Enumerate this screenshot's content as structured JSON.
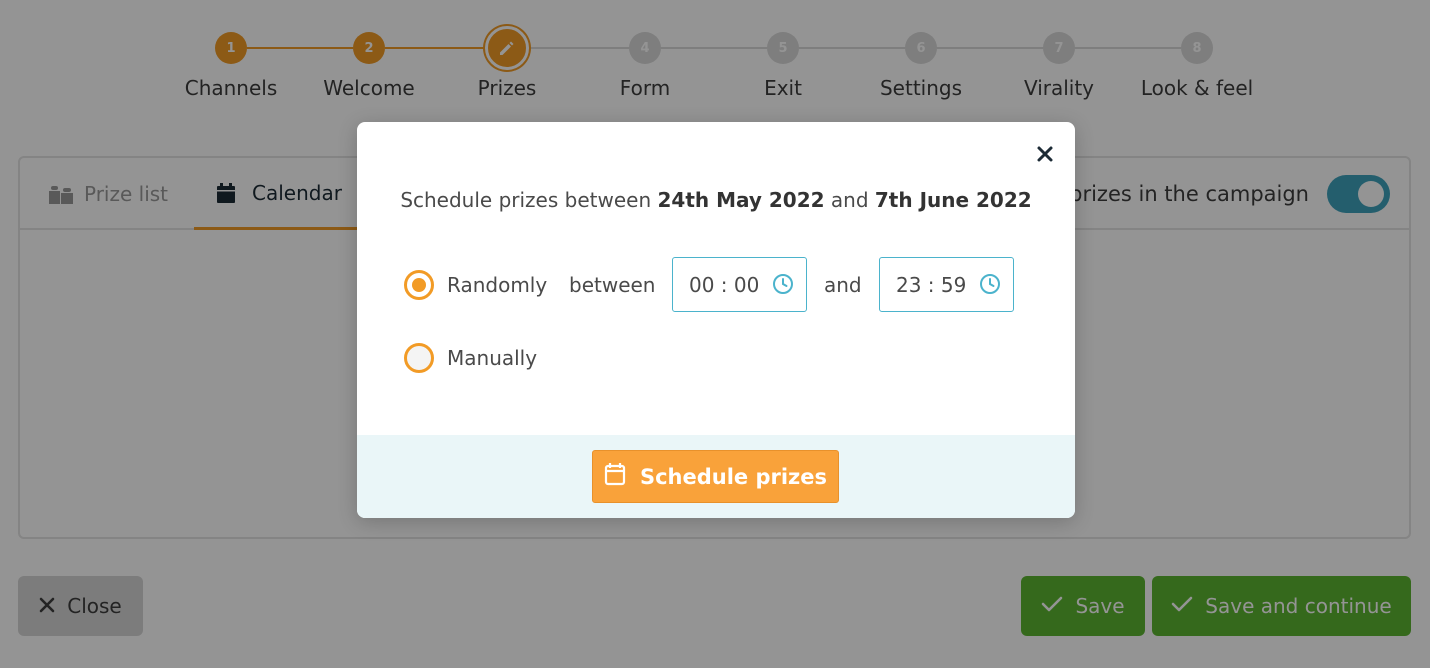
{
  "stepper": {
    "steps": [
      {
        "number": "1",
        "label": "Channels",
        "state": "done"
      },
      {
        "number": "2",
        "label": "Welcome",
        "state": "done"
      },
      {
        "number": "",
        "label": "Prizes",
        "state": "current"
      },
      {
        "number": "4",
        "label": "Form",
        "state": "todo"
      },
      {
        "number": "5",
        "label": "Exit",
        "state": "todo"
      },
      {
        "number": "6",
        "label": "Settings",
        "state": "todo"
      },
      {
        "number": "7",
        "label": "Virality",
        "state": "todo"
      },
      {
        "number": "8",
        "label": "Look & feel",
        "state": "todo"
      }
    ]
  },
  "tabs": {
    "prize_list": "Prize list",
    "calendar": "Calendar",
    "toggle_label": "e prizes in the campaign",
    "toggle_on": true
  },
  "footer": {
    "close_label": "Close",
    "save_label": "Save",
    "save_continue_label": "Save and continue"
  },
  "modal": {
    "title_prefix": "Schedule prizes between",
    "start_date": "24th May 2022",
    "title_and": "and",
    "end_date": "7th June 2022",
    "option_random": "Randomly",
    "option_manual": "Manually",
    "selected_option": "Randomly",
    "between_label": "between",
    "and_label": "and",
    "start_time": "00 : 00",
    "end_time": "23 : 59",
    "schedule_button": "Schedule prizes"
  },
  "colors": {
    "accent_orange": "#f29b26",
    "button_orange": "#f9a23a",
    "input_border_teal": "#4bb3cc",
    "toggle_teal": "#3fa2bc",
    "save_green": "#5cb531",
    "footer_bg": "#eaf6f8"
  },
  "icons": {
    "current_step": "pencil-icon",
    "prize_list_tab": "gifts-icon",
    "calendar_tab": "calendar-icon",
    "close_button": "x-icon",
    "save_buttons": "check-icon",
    "time_inputs": "clock-icon",
    "modal_close": "close-icon",
    "schedule_button": "calendar-outline-icon"
  }
}
